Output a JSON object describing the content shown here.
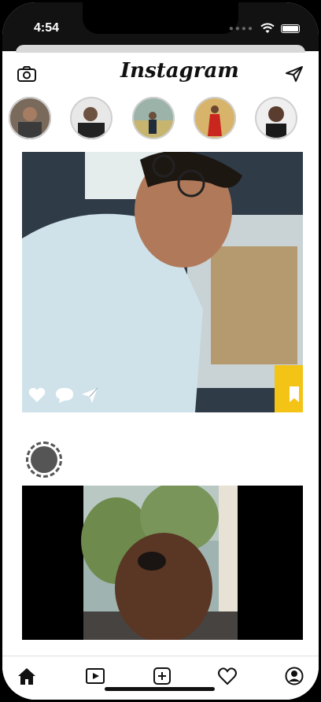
{
  "status": {
    "time": "4:54"
  },
  "header": {
    "title": "Instagram",
    "camera_icon": "camera-icon",
    "send_icon": "paper-plane-icon"
  },
  "stories": [
    {
      "id": "story-1"
    },
    {
      "id": "story-2"
    },
    {
      "id": "story-3"
    },
    {
      "id": "story-4"
    },
    {
      "id": "story-5"
    }
  ],
  "post_actions": [
    "heart-icon",
    "comment-icon",
    "share-icon",
    "bookmark-icon"
  ],
  "tabs": [
    "home-icon",
    "video-icon",
    "add-icon",
    "heart-icon",
    "profile-icon"
  ],
  "colors": {
    "accent": "#f3c316",
    "text": "#111111"
  }
}
